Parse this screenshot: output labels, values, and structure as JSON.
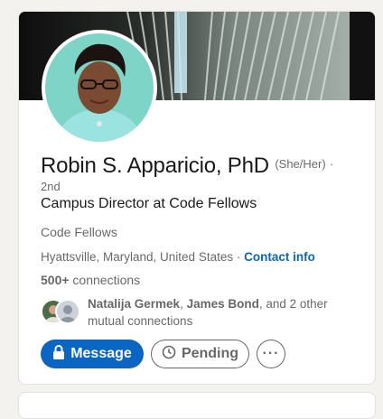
{
  "profile": {
    "name": "Robin S. Apparicio, PhD",
    "pronouns": "(She/Her)",
    "separator": "·",
    "degree": "2nd",
    "headline": "Campus Director at Code Fellows",
    "company": "Code Fellows",
    "location": "Hyattsville, Maryland, United States",
    "location_separator": " · ",
    "contact_info": "Contact info",
    "connections_count": "500+",
    "connections_label": " connections"
  },
  "mutual": {
    "name1": "Natalija Germek",
    "sep1": ", ",
    "name2": "James Bond",
    "rest": ", and 2 other mutual connections"
  },
  "actions": {
    "message_label": "Message",
    "pending_label": "Pending",
    "more_label": "···"
  },
  "icons": {
    "message": "lock-icon",
    "pending": "clock-icon",
    "more": "more-icon"
  },
  "colors": {
    "primary": "#0a66c2",
    "background": "#f3f2ef",
    "avatar_bg": "#7fd4c8"
  }
}
